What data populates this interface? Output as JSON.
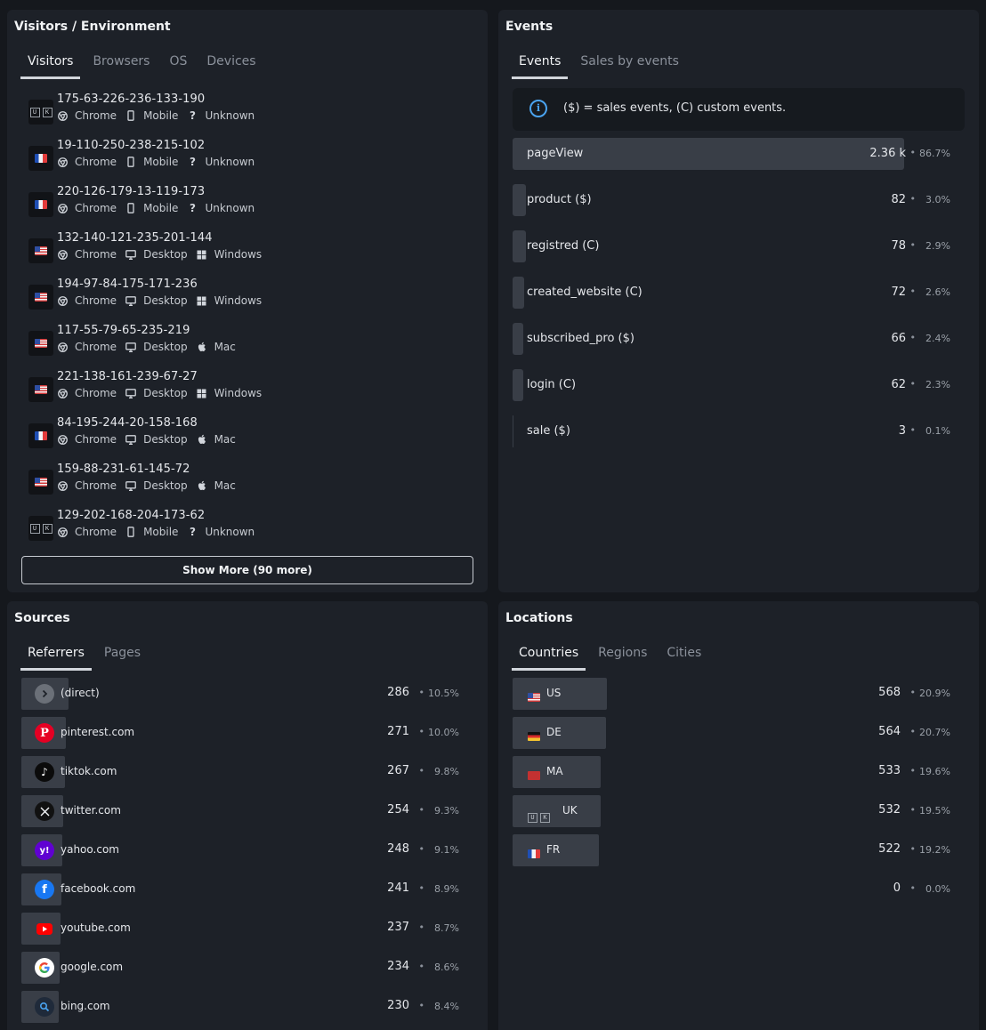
{
  "visitors_panel": {
    "title": "Visitors / Environment",
    "tabs": [
      "Visitors",
      "Browsers",
      "OS",
      "Devices"
    ],
    "rows": [
      {
        "ip": "175-63-226-236-133-190",
        "country": "uk",
        "browser": "Chrome",
        "device": "Mobile",
        "os": "Unknown"
      },
      {
        "ip": "19-110-250-238-215-102",
        "country": "fr",
        "browser": "Chrome",
        "device": "Mobile",
        "os": "Unknown"
      },
      {
        "ip": "220-126-179-13-119-173",
        "country": "fr",
        "browser": "Chrome",
        "device": "Mobile",
        "os": "Unknown"
      },
      {
        "ip": "132-140-121-235-201-144",
        "country": "us",
        "browser": "Chrome",
        "device": "Desktop",
        "os": "Windows"
      },
      {
        "ip": "194-97-84-175-171-236",
        "country": "us",
        "browser": "Chrome",
        "device": "Desktop",
        "os": "Windows"
      },
      {
        "ip": "117-55-79-65-235-219",
        "country": "us",
        "browser": "Chrome",
        "device": "Desktop",
        "os": "Mac"
      },
      {
        "ip": "221-138-161-239-67-27",
        "country": "us",
        "browser": "Chrome",
        "device": "Desktop",
        "os": "Windows"
      },
      {
        "ip": "84-195-244-20-158-168",
        "country": "fr",
        "browser": "Chrome",
        "device": "Desktop",
        "os": "Mac"
      },
      {
        "ip": "159-88-231-61-145-72",
        "country": "us",
        "browser": "Chrome",
        "device": "Desktop",
        "os": "Mac"
      },
      {
        "ip": "129-202-168-204-173-62",
        "country": "uk",
        "browser": "Chrome",
        "device": "Mobile",
        "os": "Unknown"
      }
    ],
    "uk_letters": [
      "U",
      "K"
    ],
    "show_more": "Show More (90 more)"
  },
  "events_panel": {
    "title": "Events",
    "tabs": [
      "Events",
      "Sales by events"
    ],
    "info_text": "($) = sales events, (C) custom events.",
    "info_icon": "i",
    "dot": "•",
    "rows": [
      {
        "label": "pageView",
        "value": "2.36 k",
        "pct": "86.7%",
        "share": 0.867
      },
      {
        "label": "product ($)",
        "value": "82",
        "pct": "3.0%",
        "share": 0.03
      },
      {
        "label": "registred (C)",
        "value": "78",
        "pct": "2.9%",
        "share": 0.029
      },
      {
        "label": "created_website (C)",
        "value": "72",
        "pct": "2.6%",
        "share": 0.026
      },
      {
        "label": "subscribed_pro ($)",
        "value": "66",
        "pct": "2.4%",
        "share": 0.024
      },
      {
        "label": "login (C)",
        "value": "62",
        "pct": "2.3%",
        "share": 0.023
      },
      {
        "label": "sale ($)",
        "value": "3",
        "pct": "0.1%",
        "share": 0.001
      }
    ]
  },
  "sources_panel": {
    "title": "Sources",
    "tabs": [
      "Referrers",
      "Pages"
    ],
    "rows": [
      {
        "label": "(direct)",
        "value": "286",
        "pct": "10.5%",
        "share": 0.105,
        "icon": "direct-icon"
      },
      {
        "label": "pinterest.com",
        "value": "271",
        "pct": "10.0%",
        "share": 0.1,
        "icon": "pinterest-icon"
      },
      {
        "label": "tiktok.com",
        "value": "267",
        "pct": "9.8%",
        "share": 0.098,
        "icon": "tiktok-icon"
      },
      {
        "label": "twitter.com",
        "value": "254",
        "pct": "9.3%",
        "share": 0.093,
        "icon": "x-icon"
      },
      {
        "label": "yahoo.com",
        "value": "248",
        "pct": "9.1%",
        "share": 0.091,
        "icon": "yahoo-icon"
      },
      {
        "label": "facebook.com",
        "value": "241",
        "pct": "8.9%",
        "share": 0.089,
        "icon": "facebook-icon"
      },
      {
        "label": "youtube.com",
        "value": "237",
        "pct": "8.7%",
        "share": 0.087,
        "icon": "youtube-icon"
      },
      {
        "label": "google.com",
        "value": "234",
        "pct": "8.6%",
        "share": 0.086,
        "icon": "google-icon"
      },
      {
        "label": "bing.com",
        "value": "230",
        "pct": "8.4%",
        "share": 0.084,
        "icon": "bing-icon"
      }
    ],
    "icon_glyphs": {
      "yahoo": "y!",
      "facebook": "f"
    }
  },
  "locations_panel": {
    "title": "Locations",
    "tabs": [
      "Countries",
      "Regions",
      "Cities"
    ],
    "rows": [
      {
        "label": "US",
        "value": "568",
        "pct": "20.9%",
        "share": 0.209,
        "flag": "us"
      },
      {
        "label": "DE",
        "value": "564",
        "pct": "20.7%",
        "share": 0.207,
        "flag": "de"
      },
      {
        "label": "MA",
        "value": "533",
        "pct": "19.6%",
        "share": 0.196,
        "flag": "ma"
      },
      {
        "label": "UK",
        "value": "532",
        "pct": "19.5%",
        "share": 0.195,
        "flag": "uk"
      },
      {
        "label": "FR",
        "value": "522",
        "pct": "19.2%",
        "share": 0.192,
        "flag": "fr"
      },
      {
        "label": "",
        "value": "0",
        "pct": "0.0%",
        "share": 0.0,
        "flag": ""
      }
    ]
  },
  "colors": {
    "background": "#15181d",
    "panel": "#1d2128",
    "bar": "#393e47",
    "info_accent": "#4aa3ef"
  }
}
